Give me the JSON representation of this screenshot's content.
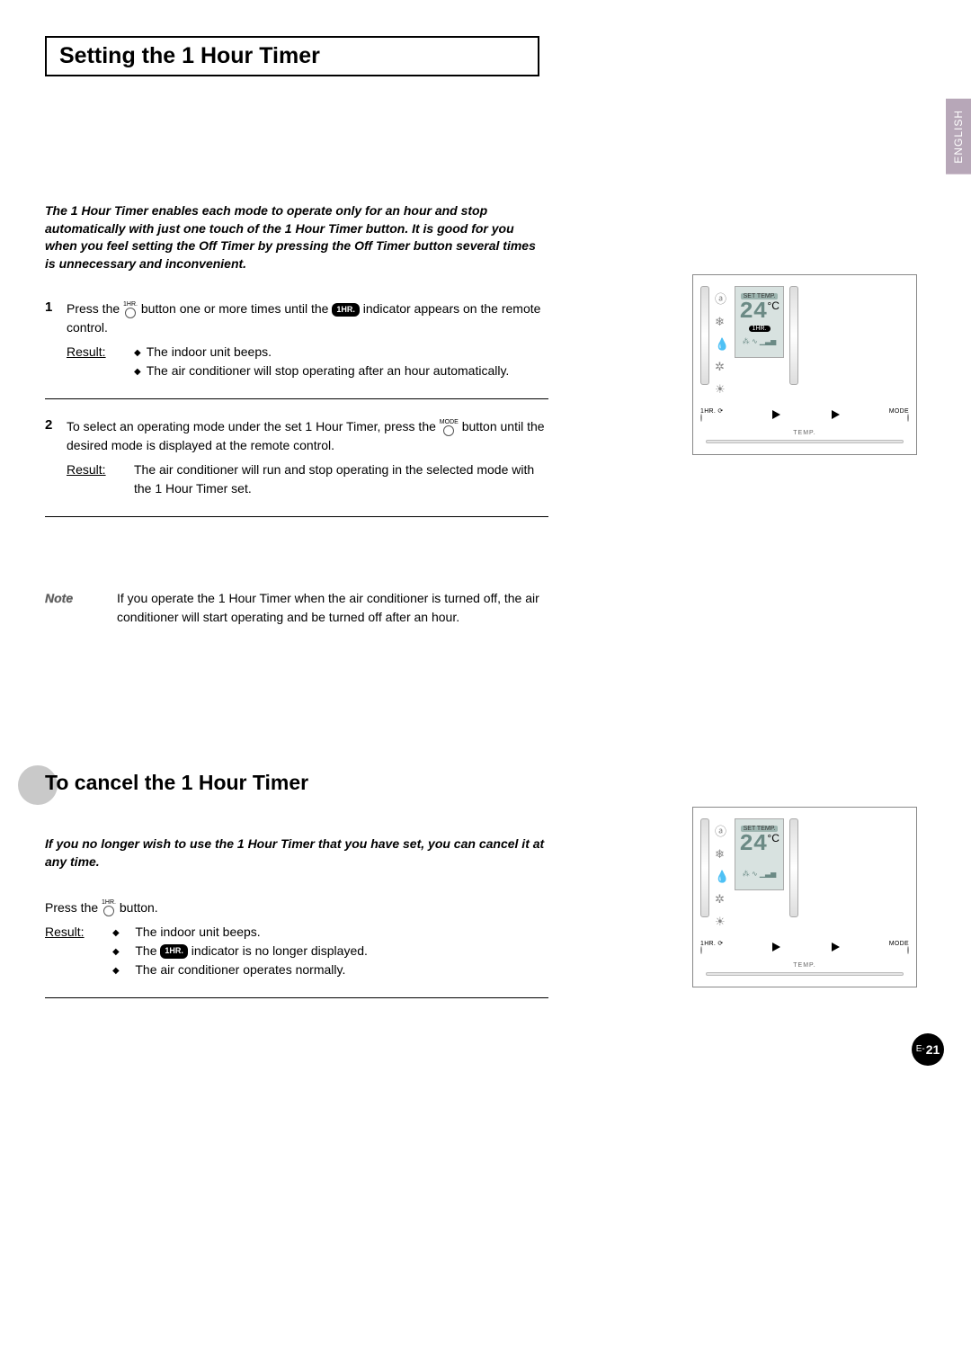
{
  "language_tab": "ENGLISH",
  "page": {
    "prefix": "E-",
    "num": "21"
  },
  "title": "Setting the 1 Hour Timer",
  "intro": "The 1 Hour Timer enables each mode to operate only for an hour and stop automatically with just one touch of the 1 Hour Timer button. It is good for you when you feel setting the Off Timer by pressing the Off Timer button several times is unnecessary and inconvenient.",
  "icon_1hr_label": "1HR.",
  "icon_mode_label": "MODE",
  "pill_1hr": "1HR.",
  "step1": {
    "num": "1",
    "text_a": "Press the ",
    "text_b": " button one or more times until the ",
    "text_c": " indicator appears on the remote control.",
    "result_label": "Result:",
    "bullets": [
      "The indoor unit beeps.",
      "The air conditioner will stop operating after an hour automatically."
    ]
  },
  "step2": {
    "num": "2",
    "text_a": "To select an operating mode under the set 1 Hour Timer, press the ",
    "text_b": " button until the desired mode is displayed at the remote control.",
    "result_label": "Result:",
    "result_text": "The air conditioner will run and stop operating in the selected mode with the 1 Hour Timer set."
  },
  "note": {
    "label": "Note",
    "text": "If you operate the 1 Hour Timer when the air conditioner is turned off, the air conditioner will start operating and be turned off after an hour."
  },
  "cancel": {
    "heading": "To cancel the 1 Hour Timer",
    "intro": "If you no longer wish to use the 1 Hour Timer that you have set, you can cancel it at any time.",
    "press_a": "Press the ",
    "press_b": " button.",
    "result_label": "Result:",
    "bullets": {
      "b1": "The indoor unit beeps.",
      "b2a": "The ",
      "b2b": " indicator is no longer displayed.",
      "b3": "The air conditioner operates normally."
    }
  },
  "remote": {
    "set_temp_label": "SET TEMP.",
    "temp_value": "24",
    "unit": "°C",
    "pill": "1HR.",
    "btn_1hr": "1HR.",
    "btn_mode": "MODE",
    "btn_temp": "TEMP."
  }
}
